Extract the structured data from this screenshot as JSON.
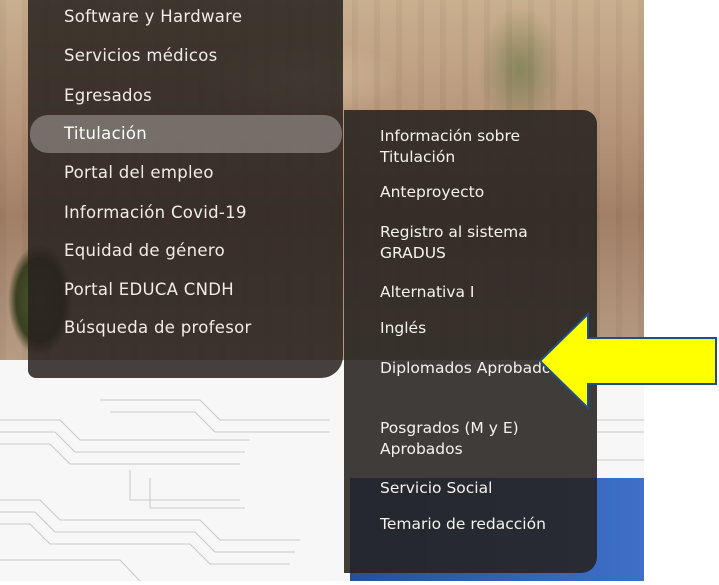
{
  "menu": {
    "items": [
      {
        "label": "Software y Hardware"
      },
      {
        "label": "Servicios médicos"
      },
      {
        "label": "Egresados"
      },
      {
        "label": "Titulación"
      },
      {
        "label": "Portal del empleo"
      },
      {
        "label": "Información Covid-19"
      },
      {
        "label": "Equidad de género"
      },
      {
        "label": "Portal EDUCA CNDH"
      },
      {
        "label": "Búsqueda de profesor"
      }
    ],
    "active_index": 3
  },
  "submenu": {
    "items": [
      {
        "label": "Información sobre Titulación"
      },
      {
        "label": "Anteproyecto"
      },
      {
        "label": "Registro al sistema GRADUS"
      },
      {
        "label": "Alternativa I"
      },
      {
        "label": "Inglés"
      },
      {
        "label": "Diplomados Aprobados"
      },
      {
        "label": "Posgrados (M y E) Aprobados"
      },
      {
        "label": "Servicio Social"
      },
      {
        "label": "Temario de redacción"
      }
    ]
  },
  "annotation": {
    "arrow_color": "#ffff00",
    "arrow_border": "#1f4e8c",
    "points_to": "Diplomados Aprobados"
  }
}
